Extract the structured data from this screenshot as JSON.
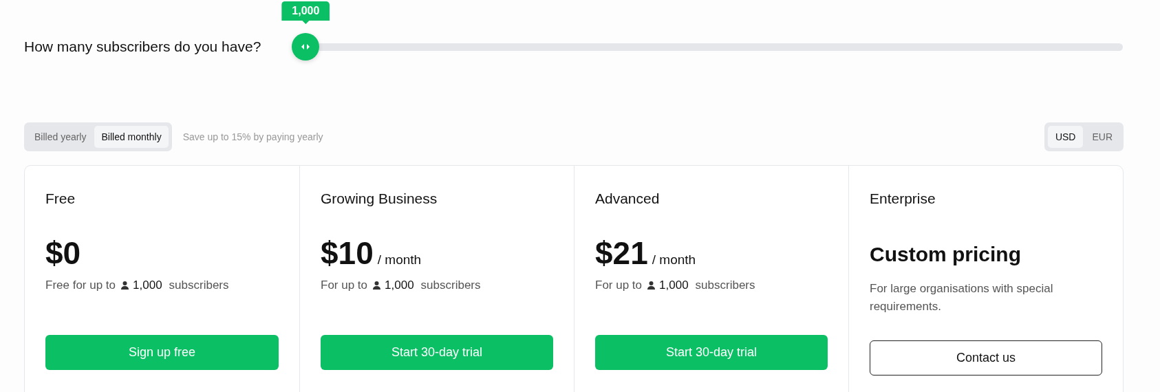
{
  "subscribers": {
    "question": "How many subscribers do you have?",
    "value": "1,000",
    "level": 0
  },
  "billing": {
    "options": [
      {
        "label": "Billed yearly",
        "selected": false
      },
      {
        "label": "Billed monthly",
        "selected": true
      }
    ],
    "note": "Save up to 15% by paying yearly"
  },
  "currency": [
    {
      "label": "USD",
      "selected": true
    },
    {
      "label": "EUR",
      "selected": false
    }
  ],
  "plans": [
    {
      "name": "Free",
      "kind": "priced",
      "price": "$0",
      "description": "Free for up to",
      "count": "1,000",
      "unit": "subscribers",
      "button": {
        "label": "Sign up free",
        "kind": "primary"
      }
    },
    {
      "name": "Growing Business",
      "kind": "priced",
      "price": "$10",
      "period": "/ month",
      "description": "For up to",
      "count": "1,000",
      "unit": "subscribers",
      "button": {
        "label": "Start 30-day trial",
        "kind": "primary"
      }
    },
    {
      "name": "Advanced",
      "kind": "priced",
      "price": "$21",
      "period": "/ month",
      "description": "For up to",
      "count": "1,000",
      "unit": "subscribers",
      "button": {
        "label": "Start 30-day trial",
        "kind": "primary"
      }
    },
    {
      "name": "Enterprise",
      "kind": "custom",
      "price": "Custom pricing",
      "description": "For large organisations with special requirements.",
      "button": {
        "label": "Contact us",
        "kind": "outline"
      }
    }
  ]
}
